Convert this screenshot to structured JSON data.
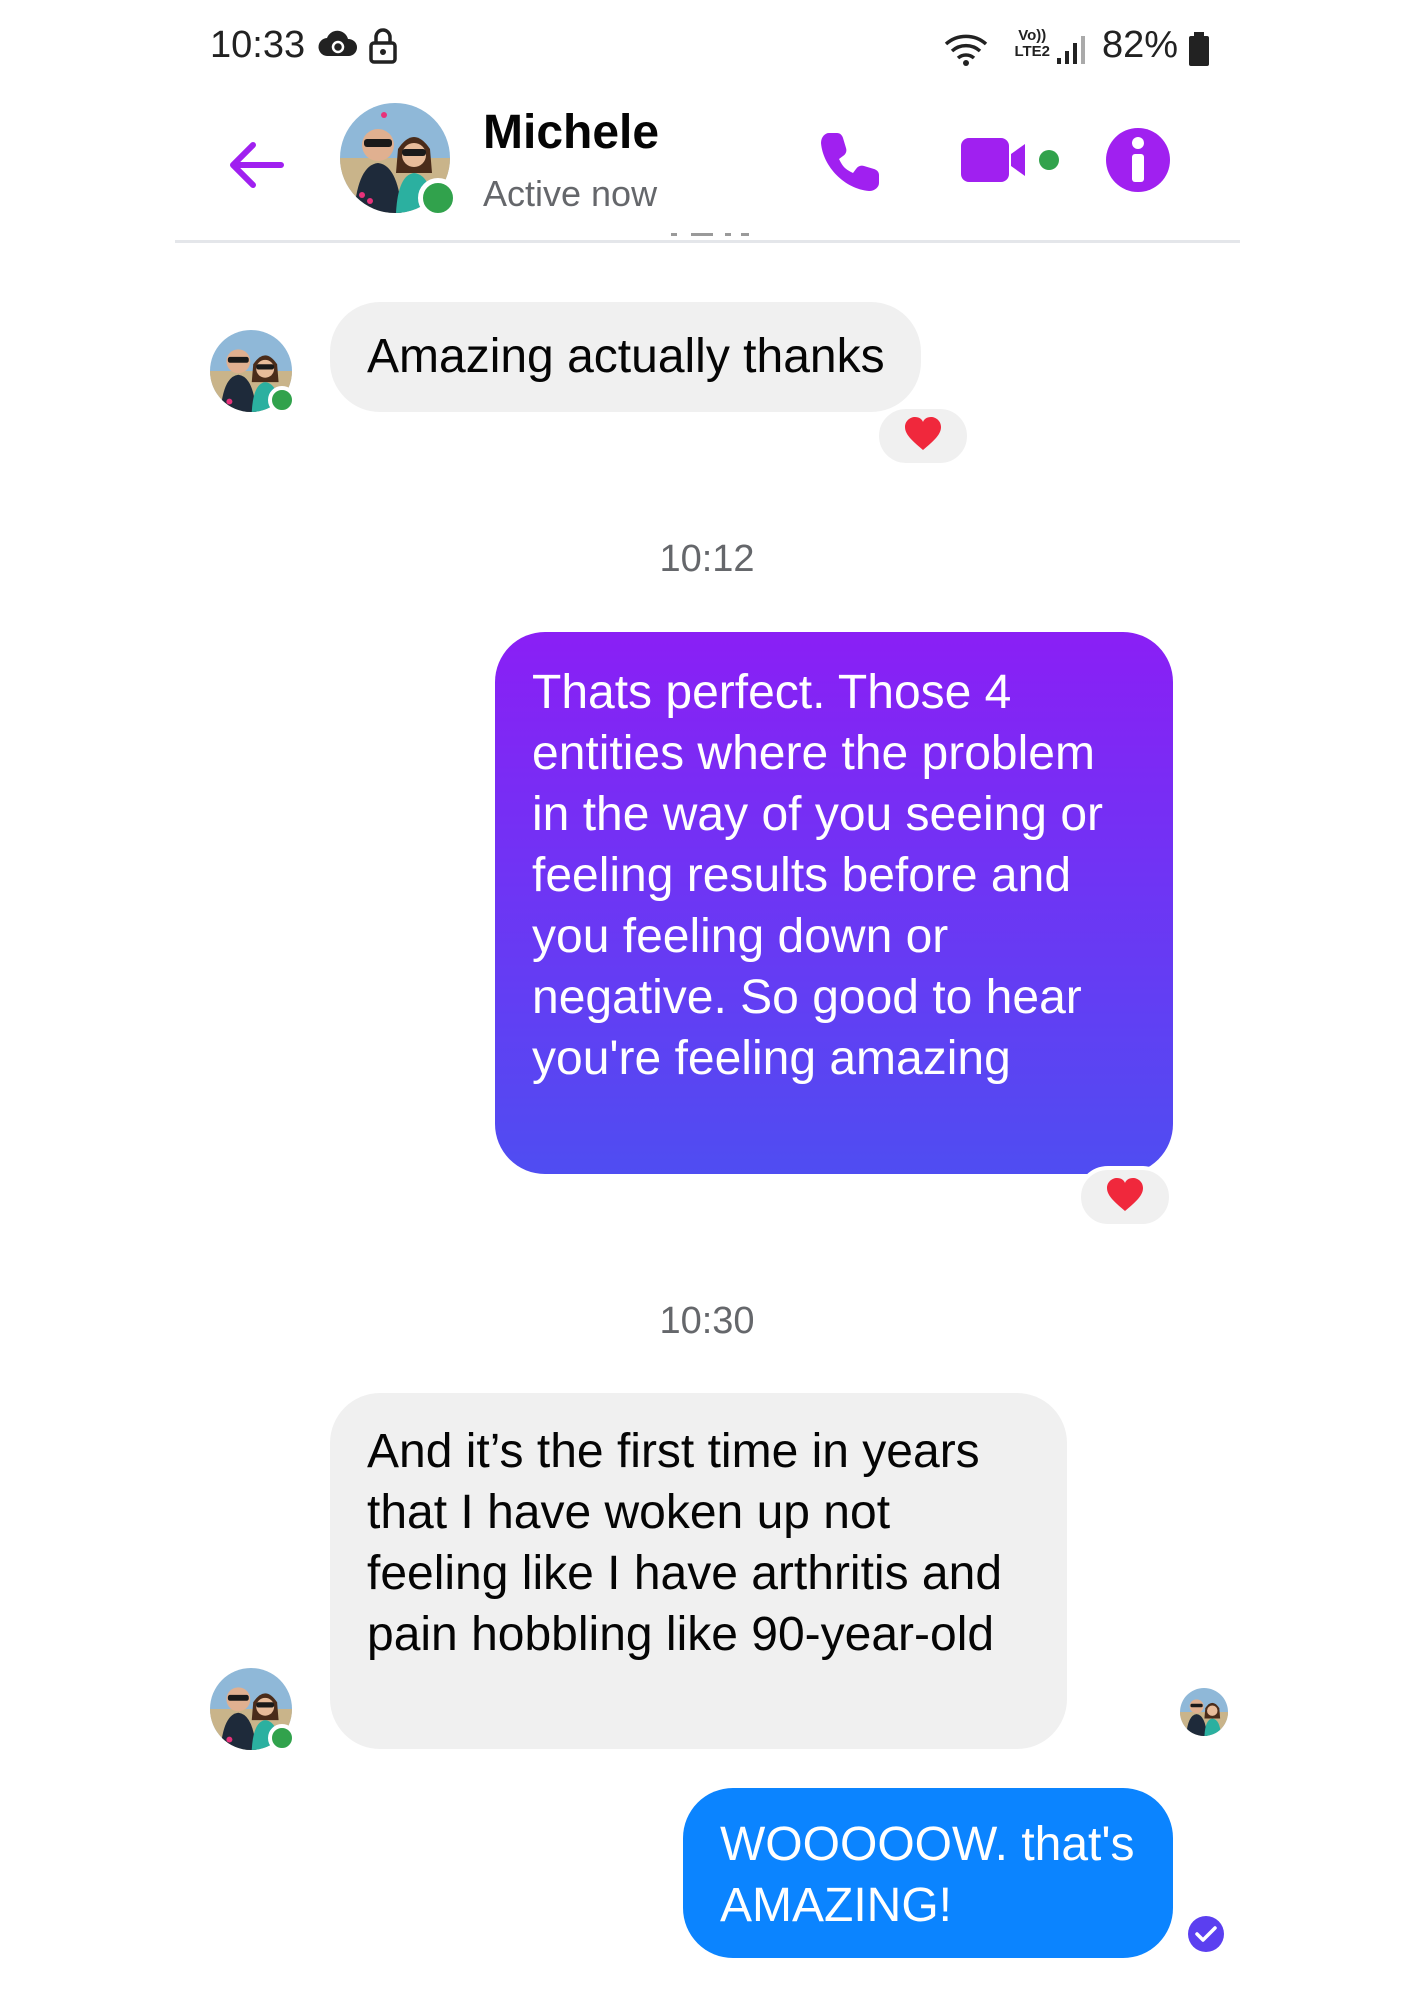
{
  "status_bar": {
    "time": "10:33",
    "volte_line1": "Vo))",
    "volte_line2": "LTE2",
    "battery": "82%"
  },
  "header": {
    "contact_name": "Michele",
    "contact_status": "Active now"
  },
  "messages": [
    {
      "direction": "incoming",
      "text": "Amazing actually thanks",
      "reaction": "heart"
    },
    {
      "type": "timestamp",
      "text": "10:12"
    },
    {
      "direction": "outgoing",
      "text": "Thats perfect. Those 4 entities where the problem in the way of you seeing or feeling results before and you feeling down or negative.  So good to hear you're feeling amazing",
      "reaction": "heart"
    },
    {
      "type": "timestamp",
      "text": "10:30"
    },
    {
      "direction": "incoming",
      "text": "And it’s the first time in years that I have woken up not feeling like I have arthritis and pain hobbling like 90-year-old"
    },
    {
      "direction": "outgoing",
      "text": "WOOOOOW. that's AMAZING!",
      "status": "sent"
    }
  ],
  "colors": {
    "accent": "#a020f0",
    "outgoing_gradient_top": "#8a1ff5",
    "outgoing_gradient_bottom": "#4f4df2",
    "outgoing_blue": "#0b84ff",
    "incoming_bubble": "#f0f0f0",
    "online": "#31a24c",
    "heart": "#f0283c"
  },
  "icons": [
    "back-arrow-icon",
    "phone-icon",
    "video-camera-icon",
    "info-icon",
    "heart-icon",
    "check-circle-icon",
    "wifi-icon",
    "signal-icon",
    "battery-icon",
    "cloud-icon",
    "lock-icon"
  ]
}
